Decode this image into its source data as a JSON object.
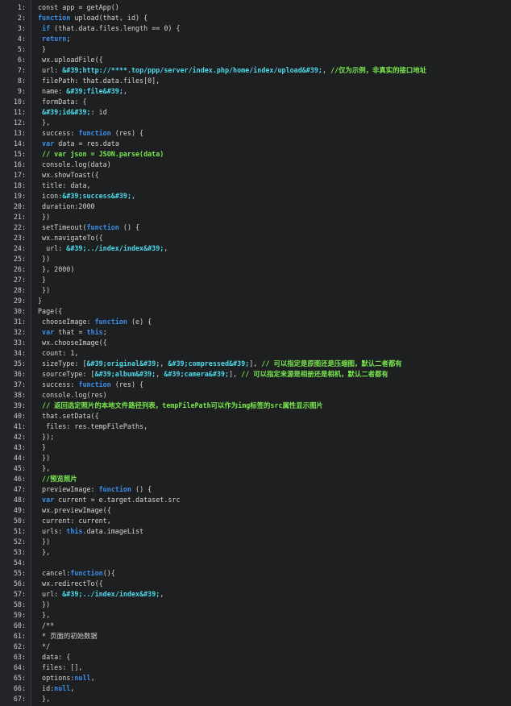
{
  "lines": [
    [
      [
        "t",
        "const app = getApp()"
      ]
    ],
    [
      [
        "k",
        "function"
      ],
      [
        "t",
        " upload(that, id) {"
      ]
    ],
    [
      [
        "t",
        " "
      ],
      [
        "k",
        "if"
      ],
      [
        "t",
        " (that.data.files.length == 0) {"
      ]
    ],
    [
      [
        "t",
        " "
      ],
      [
        "k",
        "return"
      ],
      [
        "t",
        ";"
      ]
    ],
    [
      [
        "t",
        " }"
      ]
    ],
    [
      [
        "t",
        " wx.uploadFile({"
      ]
    ],
    [
      [
        "t",
        " url: "
      ],
      [
        "s",
        "&#39;http://****.top/ppp/server/index.php/home/index/upload&#39;"
      ],
      [
        "t",
        ", "
      ],
      [
        "c",
        "//仅为示例，非真实的接口地址"
      ]
    ],
    [
      [
        "t",
        " filePath: that.data.files[0],"
      ]
    ],
    [
      [
        "t",
        " name: "
      ],
      [
        "s",
        "&#39;file&#39;"
      ],
      [
        "t",
        ","
      ]
    ],
    [
      [
        "t",
        " formData: {"
      ]
    ],
    [
      [
        "t",
        " "
      ],
      [
        "s",
        "&#39;id&#39;"
      ],
      [
        "t",
        ": id"
      ]
    ],
    [
      [
        "t",
        " },"
      ]
    ],
    [
      [
        "t",
        " success: "
      ],
      [
        "k",
        "function"
      ],
      [
        "t",
        " (res) {"
      ]
    ],
    [
      [
        "t",
        " "
      ],
      [
        "k",
        "var"
      ],
      [
        "t",
        " data = res.data"
      ]
    ],
    [
      [
        "t",
        " "
      ],
      [
        "c",
        "// var json = JSON.parse(data)"
      ]
    ],
    [
      [
        "t",
        " console.log(data)"
      ]
    ],
    [
      [
        "t",
        " wx.showToast({"
      ]
    ],
    [
      [
        "t",
        " title: data,"
      ]
    ],
    [
      [
        "t",
        " icon:"
      ],
      [
        "s",
        "&#39;success&#39;"
      ],
      [
        "t",
        ","
      ]
    ],
    [
      [
        "t",
        " duration:2000"
      ]
    ],
    [
      [
        "t",
        " })"
      ]
    ],
    [
      [
        "t",
        " setTimeout("
      ],
      [
        "k",
        "function"
      ],
      [
        "t",
        " () {"
      ]
    ],
    [
      [
        "t",
        " wx.navigateTo({"
      ]
    ],
    [
      [
        "t",
        "  url: "
      ],
      [
        "s",
        "&#39;../index/index&#39;"
      ],
      [
        "t",
        ","
      ]
    ],
    [
      [
        "t",
        " })"
      ]
    ],
    [
      [
        "t",
        " }, 2000)"
      ]
    ],
    [
      [
        "t",
        " }"
      ]
    ],
    [
      [
        "t",
        " })"
      ]
    ],
    [
      [
        "t",
        "}"
      ]
    ],
    [
      [
        "t",
        "Page({"
      ]
    ],
    [
      [
        "t",
        " chooseImage: "
      ],
      [
        "k",
        "function"
      ],
      [
        "t",
        " (e) {"
      ]
    ],
    [
      [
        "t",
        " "
      ],
      [
        "k",
        "var"
      ],
      [
        "t",
        " that = "
      ],
      [
        "k",
        "this"
      ],
      [
        "t",
        ";"
      ]
    ],
    [
      [
        "t",
        " wx.chooseImage({"
      ]
    ],
    [
      [
        "t",
        " count: 1,"
      ]
    ],
    [
      [
        "t",
        " sizeType: ["
      ],
      [
        "s",
        "&#39;original&#39;"
      ],
      [
        "t",
        ", "
      ],
      [
        "s",
        "&#39;compressed&#39;"
      ],
      [
        "t",
        "], "
      ],
      [
        "c",
        "// 可以指定是原图还是压缩图，默认二者都有"
      ]
    ],
    [
      [
        "t",
        " sourceType: ["
      ],
      [
        "s",
        "&#39;album&#39;"
      ],
      [
        "t",
        ", "
      ],
      [
        "s",
        "&#39;camera&#39;"
      ],
      [
        "t",
        "], "
      ],
      [
        "c",
        "// 可以指定来源是相册还是相机，默认二者都有"
      ]
    ],
    [
      [
        "t",
        " success: "
      ],
      [
        "k",
        "function"
      ],
      [
        "t",
        " (res) {"
      ]
    ],
    [
      [
        "t",
        " console.log(res)"
      ]
    ],
    [
      [
        "t",
        " "
      ],
      [
        "c",
        "// 返回选定照片的本地文件路径列表，tempFilePath可以作为img标签的src属性显示图片"
      ]
    ],
    [
      [
        "t",
        " that.setData({"
      ]
    ],
    [
      [
        "t",
        "  files: res.tempFilePaths,"
      ]
    ],
    [
      [
        "t",
        " });"
      ]
    ],
    [
      [
        "t",
        " }"
      ]
    ],
    [
      [
        "t",
        " })"
      ]
    ],
    [
      [
        "t",
        " },"
      ]
    ],
    [
      [
        "t",
        " "
      ],
      [
        "c",
        "//预览照片"
      ]
    ],
    [
      [
        "t",
        " previewImage: "
      ],
      [
        "k",
        "function"
      ],
      [
        "t",
        " () {"
      ]
    ],
    [
      [
        "t",
        " "
      ],
      [
        "k",
        "var"
      ],
      [
        "t",
        " current = e.target.dataset.src"
      ]
    ],
    [
      [
        "t",
        " wx.previewImage({"
      ]
    ],
    [
      [
        "t",
        " current: current,"
      ]
    ],
    [
      [
        "t",
        " urls: "
      ],
      [
        "k",
        "this"
      ],
      [
        "t",
        ".data.imageList"
      ]
    ],
    [
      [
        "t",
        " })"
      ]
    ],
    [
      [
        "t",
        " },"
      ]
    ],
    [
      [
        "t",
        ""
      ]
    ],
    [
      [
        "t",
        " cancel:"
      ],
      [
        "k",
        "function"
      ],
      [
        "t",
        "(){"
      ]
    ],
    [
      [
        "t",
        " wx.redirectTo({"
      ]
    ],
    [
      [
        "t",
        " url: "
      ],
      [
        "s",
        "&#39;../index/index&#39;"
      ],
      [
        "t",
        ","
      ]
    ],
    [
      [
        "t",
        " })"
      ]
    ],
    [
      [
        "t",
        " },"
      ]
    ],
    [
      [
        "t",
        " /**"
      ]
    ],
    [
      [
        "t",
        " * 页面的初始数据"
      ]
    ],
    [
      [
        "t",
        " */"
      ]
    ],
    [
      [
        "t",
        " data: {"
      ]
    ],
    [
      [
        "t",
        " files: [],"
      ]
    ],
    [
      [
        "t",
        " options:"
      ],
      [
        "k",
        "null"
      ],
      [
        "t",
        ","
      ]
    ],
    [
      [
        "t",
        " id:"
      ],
      [
        "k",
        "null"
      ],
      [
        "t",
        ","
      ]
    ],
    [
      [
        "t",
        " },"
      ]
    ]
  ]
}
